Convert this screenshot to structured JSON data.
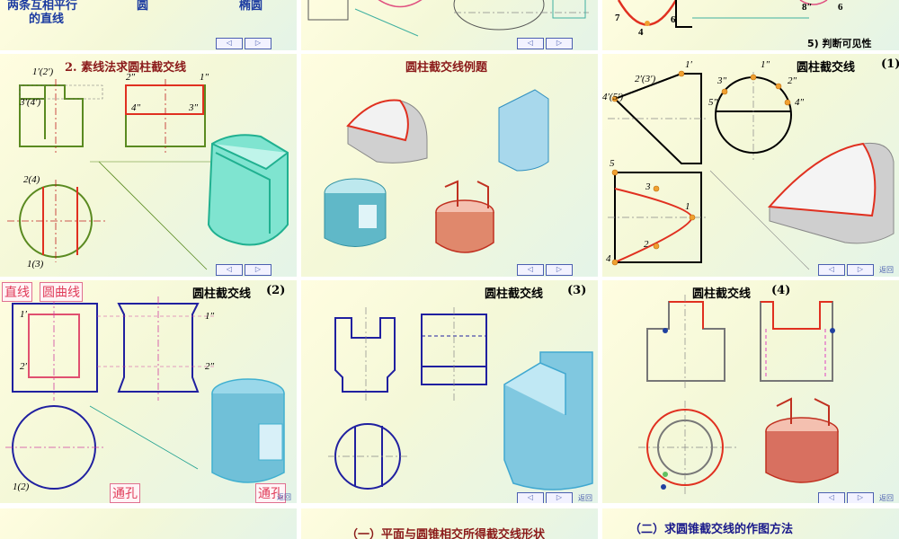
{
  "nav": {
    "prev": "◁",
    "next": "▷",
    "return": "返回"
  },
  "top_row": {
    "slide1": {
      "text1": "两条互相平行",
      "text2": "圆",
      "text3": "椭圆",
      "text4": "的直线"
    },
    "slide3": {
      "label_4": "4",
      "label_6a": "6",
      "label_7": "7",
      "label_8": "8″",
      "label_6b": "6",
      "note": "5) 判断可见性"
    }
  },
  "middle_row": {
    "s1": {
      "title": "2. 素线法求圆柱截交线",
      "labels": [
        "1′(2′)",
        "2″",
        "1″",
        "3′(4′)",
        "4″",
        "3″",
        "2(4)",
        "1(3)"
      ]
    },
    "s2": {
      "title": "圆柱截交线例题"
    },
    "s3": {
      "title": "圆柱截交线",
      "num": "(1)",
      "labels": [
        "2′(3′)",
        "1′",
        "1″",
        "3″",
        "2″",
        "4′(5′)",
        "5″",
        "4″",
        "5",
        "3",
        "1",
        "2",
        "4"
      ]
    }
  },
  "row3": {
    "s1": {
      "title": "圆柱截交线",
      "num": "(2)",
      "tag_line": "直线",
      "tag_curve": "圆曲线",
      "tag_hole1": "通孔",
      "tag_hole2": "通孔",
      "labels": [
        "1′",
        "2′",
        "1″",
        "2″",
        "1(2)"
      ]
    },
    "s2": {
      "title": "圆柱截交线",
      "num": "(3)"
    },
    "s3": {
      "title": "圆柱截交线",
      "num": "(4)"
    }
  },
  "bottom_row": {
    "s2": {
      "title": "（一）平面与圆锥相交所得截交线形状"
    },
    "s3": {
      "title": "（二）求圆锥截交线的作图方法"
    }
  }
}
